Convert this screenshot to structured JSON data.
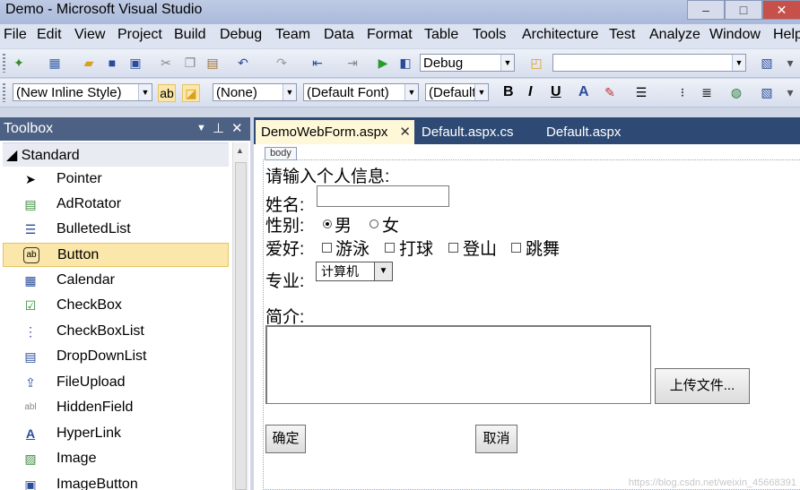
{
  "window": {
    "title": "Demo - Microsoft Visual Studio"
  },
  "menu": [
    "File",
    "Edit",
    "View",
    "Project",
    "Build",
    "Debug",
    "Team",
    "Data",
    "Format",
    "Table",
    "Tools",
    "Architecture",
    "Test",
    "Analyze",
    "Window",
    "Help"
  ],
  "toolbar1": {
    "config_value": "Debug",
    "find_value": ""
  },
  "toolbar2": {
    "style_value": "(New Inline Style)",
    "block_value": "(None)",
    "font_value": "(Default Font)",
    "size_value": "(Default"
  },
  "toolbox": {
    "title": "Toolbox",
    "group": "Standard",
    "items": [
      "Pointer",
      "AdRotator",
      "BulletedList",
      "Button",
      "Calendar",
      "CheckBox",
      "CheckBoxList",
      "DropDownList",
      "FileUpload",
      "HiddenField",
      "HyperLink",
      "Image",
      "ImageButton"
    ],
    "selected": "Button"
  },
  "tabs": [
    "DemoWebForm.aspx",
    "Default.aspx.cs",
    "Default.aspx"
  ],
  "designer": {
    "body_tag": "body",
    "heading": "请输入个人信息:",
    "name_label": "姓名:",
    "gender_label": "性别:",
    "gender_male": "男",
    "gender_female": "女",
    "hobby_label": "爱好:",
    "hobbies": [
      "游泳",
      "打球",
      "登山",
      "跳舞"
    ],
    "major_label": "专业:",
    "major_value": "计算机",
    "intro_label": "简介:",
    "upload_button": "上传文件...",
    "ok_button": "确定",
    "cancel_button": "取消"
  },
  "watermark": "https://blog.csdn.net/weixin_45668391"
}
